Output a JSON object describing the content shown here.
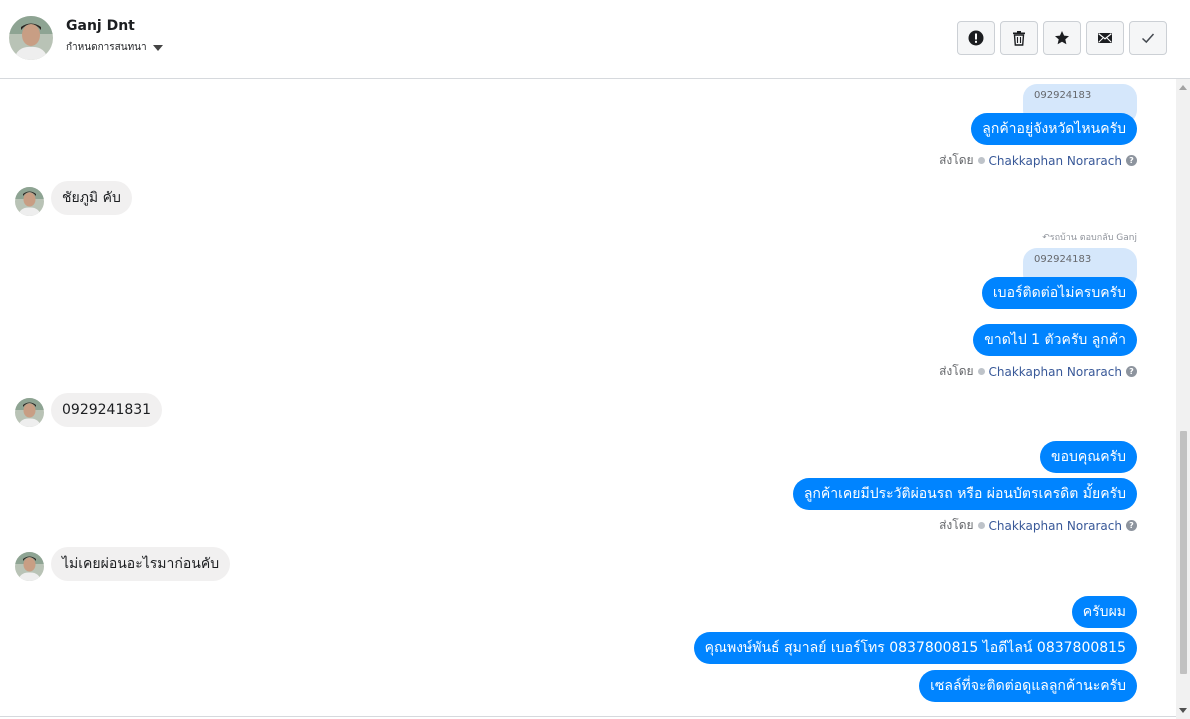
{
  "header": {
    "contact_name": "Ganj Dnt",
    "assign_label": "กำหนดการสนทนา",
    "actions": [
      {
        "name": "spam",
        "icon": "alert-icon"
      },
      {
        "name": "delete",
        "icon": "trash-icon"
      },
      {
        "name": "star",
        "icon": "star-icon"
      },
      {
        "name": "unread",
        "icon": "envelope-icon"
      },
      {
        "name": "done",
        "icon": "check-icon"
      }
    ]
  },
  "messages": [
    {
      "type": "reply_chip",
      "text": "092924183"
    },
    {
      "type": "out",
      "text": "ลูกค้าอยู่จังหวัดไหนครับ"
    },
    {
      "type": "sent_by",
      "prefix": "ส่งโดย",
      "name": "Chakkaphan Norarach"
    },
    {
      "type": "in",
      "text": "ชัยภูมิ คับ"
    },
    {
      "type": "reply_note",
      "text": "รถบ้าน ตอบกลับ Ganj"
    },
    {
      "type": "reply_chip",
      "text": "092924183"
    },
    {
      "type": "out",
      "text": "เบอร์ติดต่อไม่ครบครับ"
    },
    {
      "type": "out",
      "text": "ขาดไป 1 ตัวครับ ลูกค้า"
    },
    {
      "type": "sent_by",
      "prefix": "ส่งโดย",
      "name": "Chakkaphan Norarach"
    },
    {
      "type": "in",
      "text": "0929241831"
    },
    {
      "type": "out",
      "text": "ขอบคุณครับ"
    },
    {
      "type": "out",
      "text": "ลูกค้าเคยมีประวัติผ่อนรถ หรือ ผ่อนบัตรเครดิต มั้ยครับ"
    },
    {
      "type": "sent_by",
      "prefix": "ส่งโดย",
      "name": "Chakkaphan Norarach"
    },
    {
      "type": "in",
      "text": "ไม่เคยผ่อนอะไรมาก่อนคับ"
    },
    {
      "type": "out",
      "text": "ครับผม"
    },
    {
      "type": "out",
      "text": "คุณพงษ์พันธ์ สุมาลย์      เบอร์โทร 0837800815  ไอดีไลน์ 0837800815"
    },
    {
      "type": "out",
      "text": "เซลล์ที่จะติดต่อดูแลลูกค้านะครับ"
    }
  ],
  "colors": {
    "outgoing_bubble": "#0084ff",
    "incoming_bubble": "#f1f0f0",
    "reply_chip": "#d5e7fb",
    "sender_link": "#385898"
  }
}
